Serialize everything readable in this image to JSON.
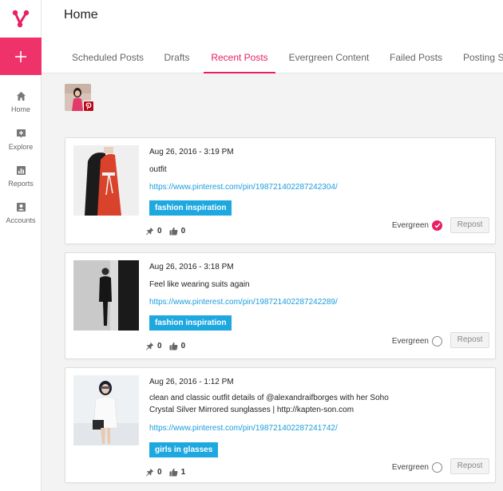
{
  "sidebar": {
    "logo_icon": "vero-logo-icon",
    "compose_icon": "plus-icon",
    "accent_color": "#f0326b",
    "items": [
      {
        "label": "Home",
        "icon": "home-icon"
      },
      {
        "label": "Explore",
        "icon": "explore-icon"
      },
      {
        "label": "Reports",
        "icon": "bar-chart-icon"
      },
      {
        "label": "Accounts",
        "icon": "account-icon"
      }
    ]
  },
  "header": {
    "title": "Home",
    "tabs": [
      {
        "label": "Scheduled Posts",
        "active": false
      },
      {
        "label": "Drafts",
        "active": false
      },
      {
        "label": "Recent Posts",
        "active": true
      },
      {
        "label": "Evergreen Content",
        "active": false
      },
      {
        "label": "Failed Posts",
        "active": false
      },
      {
        "label": "Posting S",
        "active": false
      }
    ]
  },
  "account": {
    "network_icon": "pinterest-icon"
  },
  "posts": [
    {
      "date": "Aug 26, 2016 - 3:19 PM",
      "text": "outfit",
      "link": "https://www.pinterest.com/pin/198721402287242304/",
      "tag": "fashion inspiration",
      "pins": "0",
      "likes": "0",
      "evergreen_label": "Evergreen",
      "evergreen": true,
      "repost_label": "Repost"
    },
    {
      "date": "Aug 26, 2016 - 3:18 PM",
      "text": "Feel like wearing suits again",
      "link": "https://www.pinterest.com/pin/198721402287242289/",
      "tag": "fashion inspiration",
      "pins": "0",
      "likes": "0",
      "evergreen_label": "Evergreen",
      "evergreen": false,
      "repost_label": "Repost"
    },
    {
      "date": "Aug 26, 2016 - 1:12 PM",
      "text": "clean and classic outfit details of @alexandraifborges with her Soho Crystal Silver Mirrored sunglasses | http://kapten-son.com",
      "link": "https://www.pinterest.com/pin/198721402287241742/",
      "tag": "girls in glasses",
      "pins": "0",
      "likes": "1",
      "evergreen_label": "Evergreen",
      "evergreen": false,
      "repost_label": "Repost"
    }
  ]
}
